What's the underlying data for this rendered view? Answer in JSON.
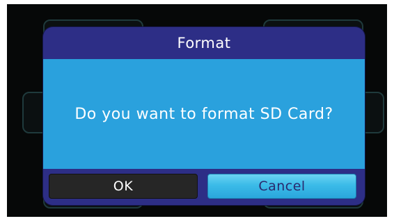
{
  "dialog": {
    "title": "Format",
    "message": "Do you want to format SD Card?",
    "buttons": {
      "ok_label": "OK",
      "cancel_label": "Cancel",
      "selected": "Cancel"
    }
  },
  "colors": {
    "dialog_frame": "#2d2e86",
    "dialog_body": "#2aa1dd",
    "ok_button": "#262626",
    "cancel_button_selected": "#3bbbe8",
    "screen_background": "#060808"
  }
}
